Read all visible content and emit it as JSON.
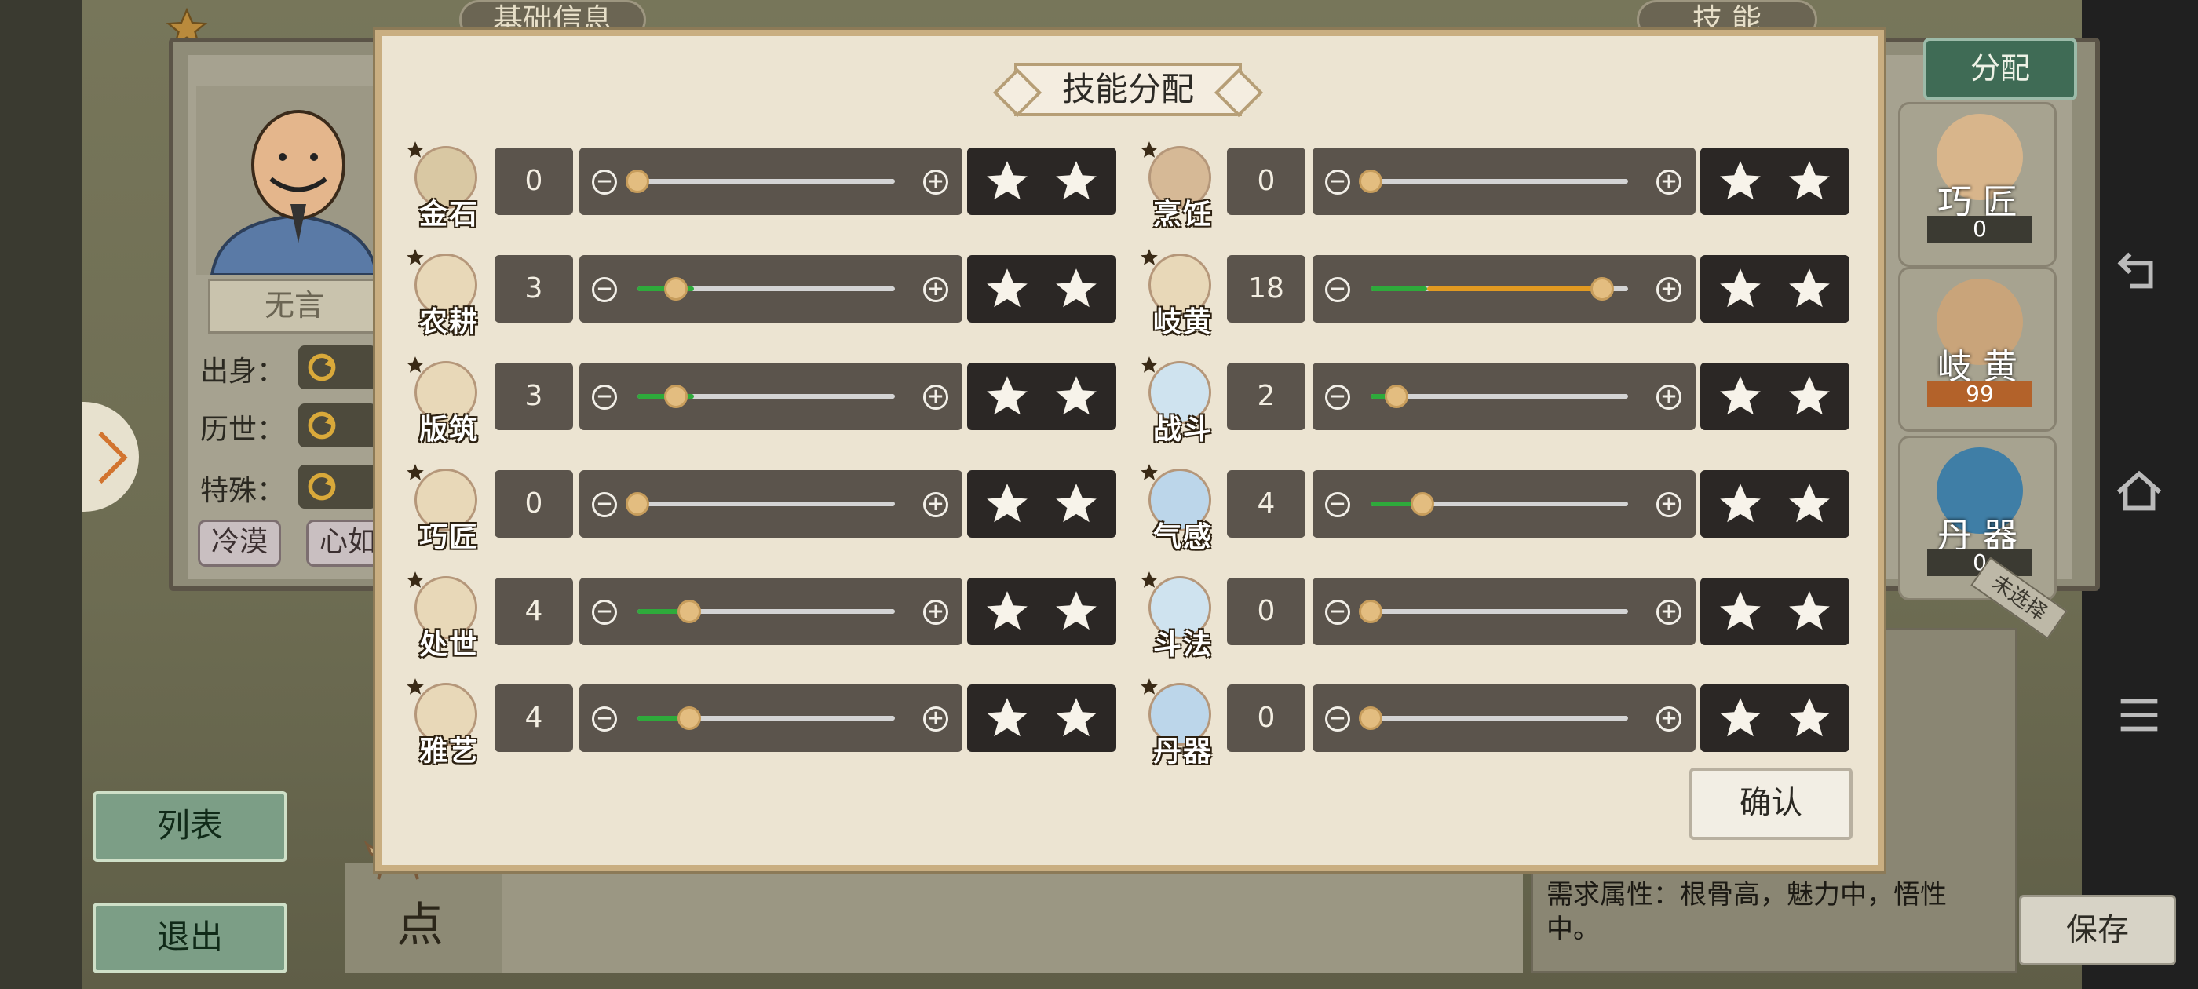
{
  "background": {
    "tabs": {
      "basic_info": "基础信息",
      "skills": "技 能"
    },
    "character_name": "无言",
    "attributes": [
      {
        "label": "出身："
      },
      {
        "label": "历世："
      },
      {
        "label": "特殊："
      }
    ],
    "traits": [
      "冷漠",
      "心如"
    ],
    "list_button": "列表",
    "exit_button": "退出",
    "dot_label": "点",
    "allocate_button": "分配",
    "skill_cards": [
      {
        "name": "巧 匠",
        "value": "0"
      },
      {
        "name": "岐 黄",
        "value": "99"
      },
      {
        "name": "丹 器",
        "value": "0"
      }
    ],
    "unselected_label": "未选择",
    "description_lines": [
      "需求属性：根骨高，魅力中，悟性",
      "中。"
    ],
    "save_button": "保存"
  },
  "dialog": {
    "title": "技能分配",
    "confirm_button": "确认",
    "max_value": 20,
    "skills_left": [
      {
        "name": "金石",
        "value": "0",
        "level": 0,
        "icon": "pickaxe-icon",
        "color": "#d9c8a3"
      },
      {
        "name": "农耕",
        "value": "3",
        "level": 3,
        "icon": "wheat-icon",
        "color": "#e8d8b8"
      },
      {
        "name": "版筑",
        "value": "3",
        "level": 3,
        "icon": "building-icon",
        "color": "#e8d8b8"
      },
      {
        "name": "巧匠",
        "value": "0",
        "level": 0,
        "icon": "hammer-icon",
        "color": "#e8d8b8"
      },
      {
        "name": "处世",
        "value": "4",
        "level": 4,
        "icon": "speech-icon",
        "color": "#e8d8b8"
      },
      {
        "name": "雅艺",
        "value": "4",
        "level": 4,
        "icon": "brush-icon",
        "color": "#e8d8b8"
      }
    ],
    "skills_right": [
      {
        "name": "烹饪",
        "value": "0",
        "level": 0,
        "icon": "bowl-icon",
        "color": "#d6b996"
      },
      {
        "name": "岐黄",
        "value": "18",
        "level": 18,
        "icon": "mortar-icon",
        "color": "#e8d8b8"
      },
      {
        "name": "战斗",
        "value": "2",
        "level": 2,
        "icon": "sword-icon",
        "color": "#cfe3ef"
      },
      {
        "name": "气感",
        "value": "4",
        "level": 4,
        "icon": "swirl-icon",
        "color": "#bcd6ea"
      },
      {
        "name": "斗法",
        "value": "0",
        "level": 0,
        "icon": "lightning-icon",
        "color": "#cfe3ef"
      },
      {
        "name": "丹器",
        "value": "0",
        "level": 0,
        "icon": "cauldron-icon",
        "color": "#bcd6ea"
      }
    ]
  }
}
